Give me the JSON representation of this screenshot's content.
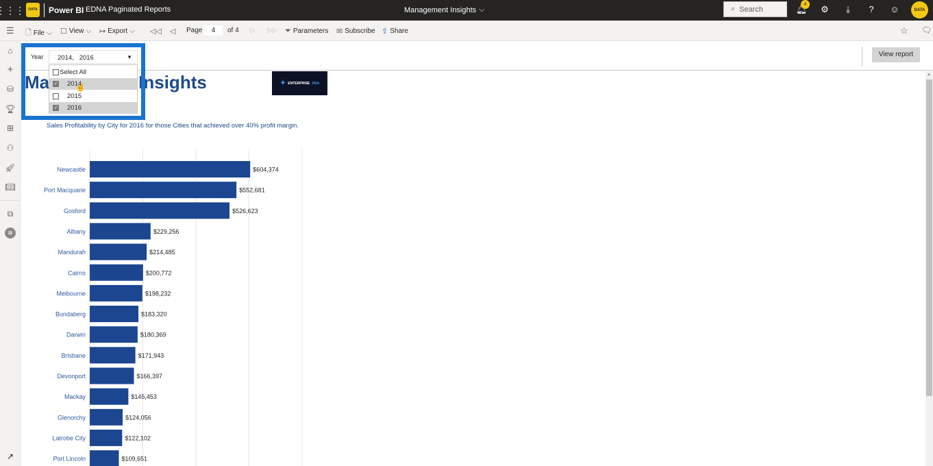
{
  "topbar": {
    "app_name": "Power BI",
    "workspace": "EDNA Paginated Reports",
    "report_title": "Management Insights",
    "search_placeholder": "Search",
    "notification_count": "4",
    "logo_text": "DATA",
    "avatar_text": "DATA"
  },
  "toolbar": {
    "file": "File",
    "view": "View",
    "export": "Export",
    "page_label": "Page",
    "page_value": "4",
    "page_of": "of 4",
    "parameters": "Parameters",
    "subscribe": "Subscribe",
    "share": "Share"
  },
  "parameters": {
    "year_label": "Year",
    "year_value": "2014,   2016",
    "options": [
      {
        "label": "Select All",
        "checked": false
      },
      {
        "label": "2014",
        "checked": true
      },
      {
        "label": "2015",
        "checked": false
      },
      {
        "label": "2016",
        "checked": true
      }
    ],
    "view_report": "View report"
  },
  "report": {
    "title": "Management Insights",
    "logo_text": "ENTERPRISE",
    "logo_text2": "DNA",
    "subtitle": "Sales Profitability by City for 2016 for those Cities that achieved over 40% profit margin."
  },
  "colors": {
    "bar": "#1c4690",
    "accent": "#1a73d0",
    "brand_yellow": "#f2c811"
  },
  "chart_data": {
    "type": "bar",
    "orientation": "horizontal",
    "title": "Sales Profitability by City for 2016 for those Cities that achieved over 40% profit margin.",
    "categories": [
      "Newcastle",
      "Port Macquarie",
      "Gosford",
      "Albany",
      "Mandurah",
      "Cairns",
      "Melbourne",
      "Bundaberg",
      "Darwin",
      "Brisbane",
      "Devonport",
      "Mackay",
      "Glenorchy",
      "Latrobe City",
      "Port Lincoln"
    ],
    "values": [
      604374,
      552681,
      526623,
      229256,
      214485,
      200772,
      198232,
      183320,
      180369,
      171943,
      166397,
      145453,
      124056,
      122102,
      109651
    ],
    "labels": [
      "$604,374",
      "$552,681",
      "$526,623",
      "$229,256",
      "$214,485",
      "$200,772",
      "$198,232",
      "$183,320",
      "$180,369",
      "$171,943",
      "$166,397",
      "$145,453",
      "$124,056",
      "$122,102",
      "$109,651"
    ],
    "xlim": [
      0,
      800000
    ],
    "grid": true,
    "xlabel": "",
    "ylabel": ""
  }
}
